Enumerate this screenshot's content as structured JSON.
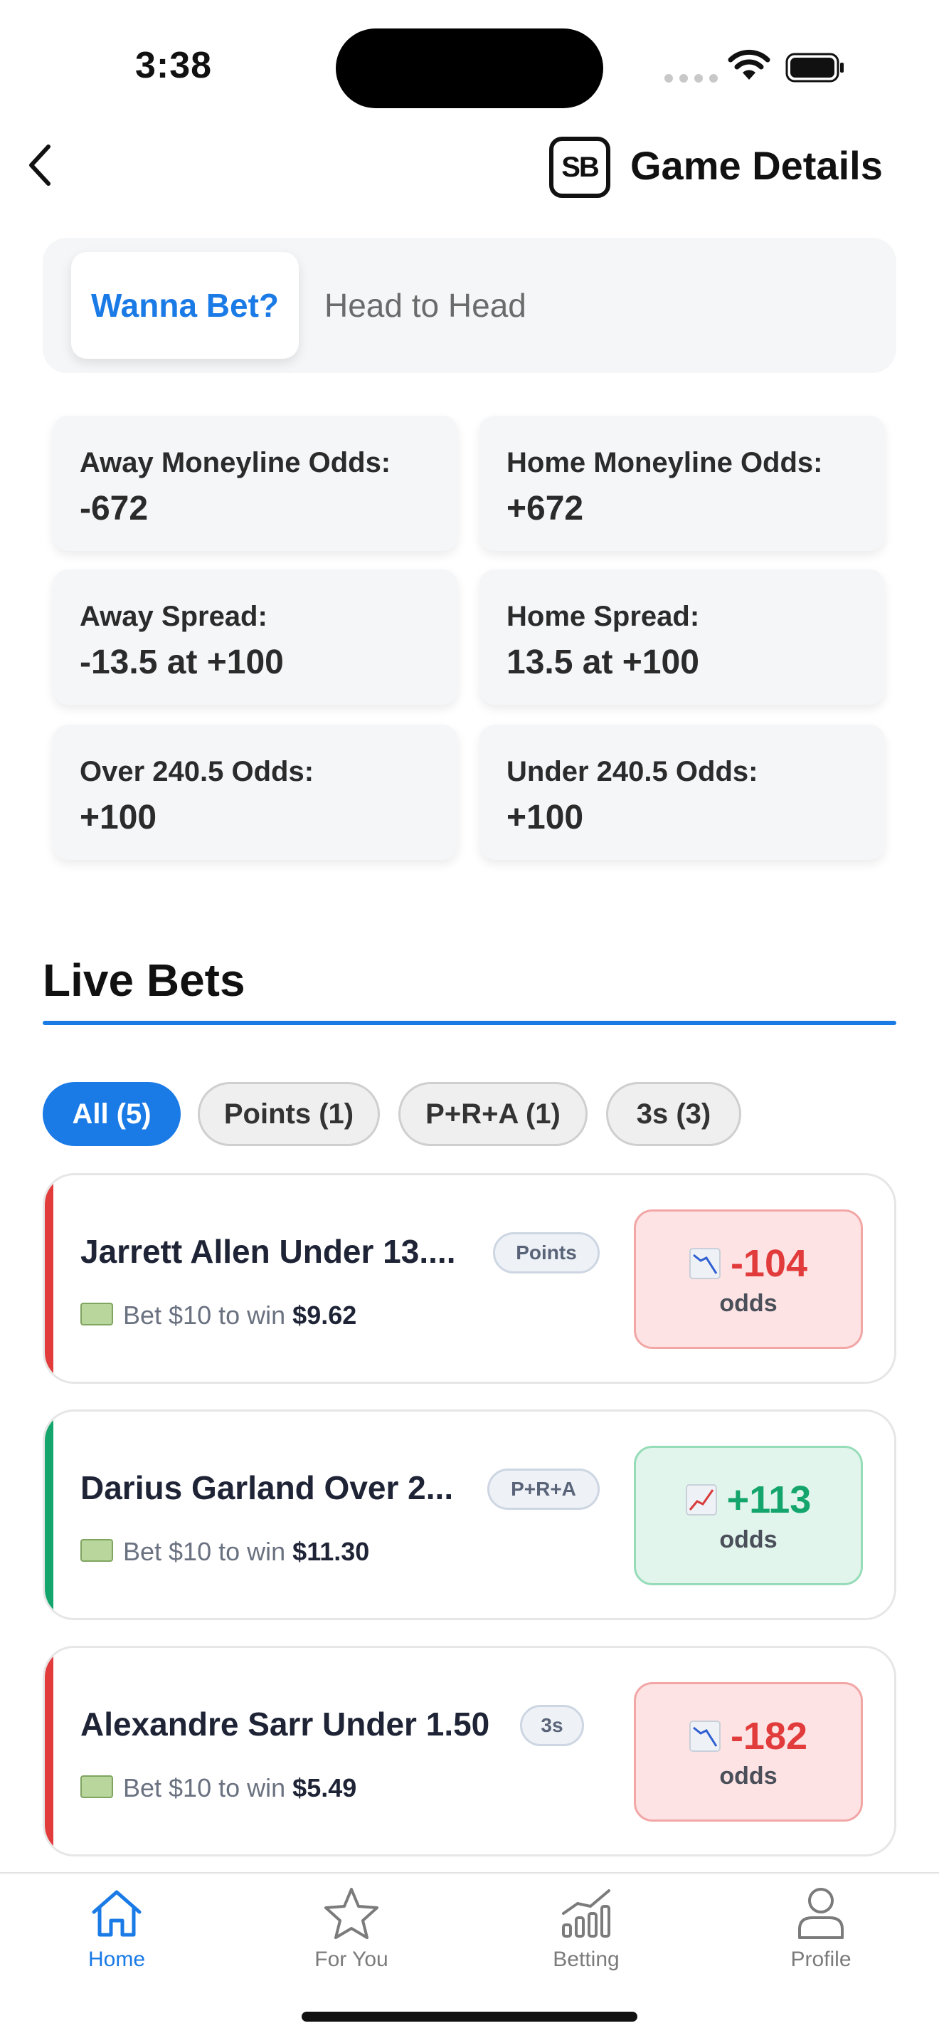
{
  "status": {
    "time": "3:38"
  },
  "header": {
    "logo_text": "SB",
    "title": "Game Details"
  },
  "segments": {
    "active": "Wanna Bet?",
    "inactive": "Head to Head"
  },
  "odds_cards": [
    {
      "label": "Away Moneyline Odds:",
      "value": "-672"
    },
    {
      "label": "Home Moneyline Odds:",
      "value": "+672"
    },
    {
      "label": "Away Spread:",
      "value": "-13.5 at +100"
    },
    {
      "label": "Home Spread:",
      "value": "13.5 at +100"
    },
    {
      "label": "Over 240.5 Odds:",
      "value": "+100"
    },
    {
      "label": "Under 240.5 Odds:",
      "value": "+100"
    }
  ],
  "live_bets": {
    "title": "Live Bets",
    "filters": [
      {
        "label": "All (5)"
      },
      {
        "label": "Points (1)"
      },
      {
        "label": "P+R+A (1)"
      },
      {
        "label": "3s (3)"
      }
    ],
    "bets": [
      {
        "name": "Jarrett Allen Under 13....",
        "tag": "Points",
        "bet_text": "Bet $10 to win",
        "win": "$9.62",
        "odds": "-104",
        "odds_label": "odds",
        "trend": "down",
        "color": "#e23b3b"
      },
      {
        "name": "Darius Garland Over 2...",
        "tag": "P+R+A",
        "bet_text": "Bet $10 to win",
        "win": "$11.30",
        "odds": "+113",
        "odds_label": "odds",
        "trend": "up",
        "color": "#13a56b"
      },
      {
        "name": "Alexandre Sarr Under 1.50",
        "tag": "3s",
        "bet_text": "Bet $10 to win",
        "win": "$5.49",
        "odds": "-182",
        "odds_label": "odds",
        "trend": "down",
        "color": "#e23b3b"
      }
    ]
  },
  "tabbar": {
    "items": [
      {
        "label": "Home",
        "icon": "home-icon",
        "active": true
      },
      {
        "label": "For You",
        "icon": "star-icon",
        "active": false
      },
      {
        "label": "Betting",
        "icon": "chart-icon",
        "active": false
      },
      {
        "label": "Profile",
        "icon": "person-icon",
        "active": false
      }
    ]
  },
  "colors": {
    "accent": "#1a7ae6",
    "negative": "#e23b3b",
    "positive": "#13a56b"
  }
}
